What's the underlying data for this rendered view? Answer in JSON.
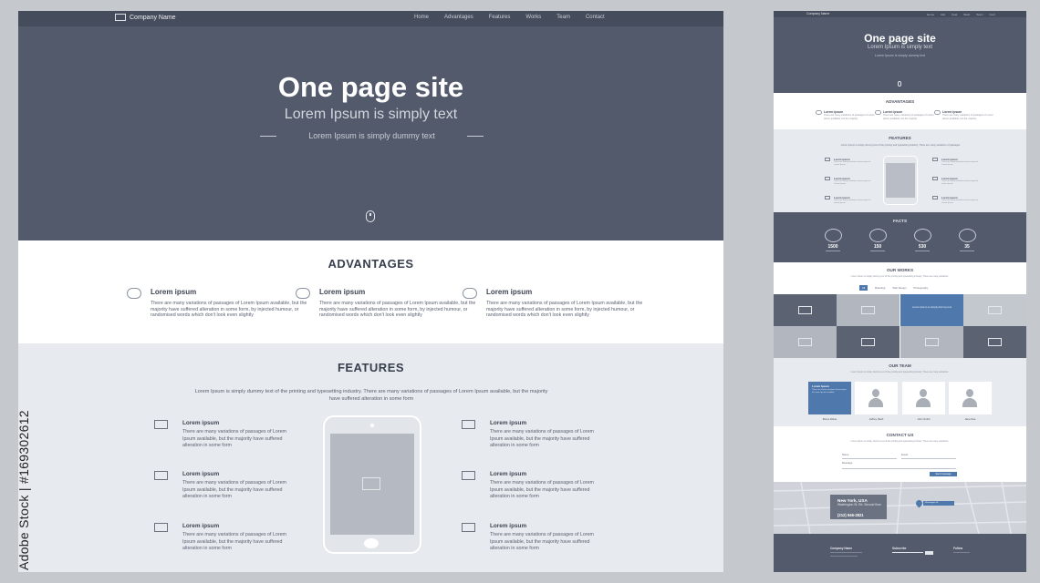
{
  "main": {
    "logo": "Company Name",
    "nav": [
      "Home",
      "Advantages",
      "Features",
      "Works",
      "Team",
      "Contact"
    ],
    "hero": {
      "title": "One page site",
      "subtitle": "Lorem Ipsum is simply text",
      "tagline": "Lorem Ipsum is simply dummy text"
    },
    "advantages": {
      "title": "ADVANTAGES",
      "items": [
        {
          "title": "Lorem ipsum",
          "text": "There are many variations of passages of Lorem Ipsum available, but the majority have suffered alteration in some form, by injected humour, or randomised words which don't look even slightly"
        },
        {
          "title": "Lorem ipsum",
          "text": "There are many variations of passages of Lorem Ipsum available, but the majority have suffered alteration in some form, by injected humour, or randomised words which don't look even slightly"
        },
        {
          "title": "Lorem ipsum",
          "text": "There are many variations of passages of Lorem Ipsum available, but the majority have suffered alteration in some form, by injected humour, or randomised words which don't look even slightly"
        }
      ]
    },
    "features": {
      "title": "FEATURES",
      "intro": "Lorem Ipsum is simply dummy text of the printing and typesetting industry. There are many variations of passages of Lorem Ipsum available, but the majority have suffered alteration in some form",
      "items": [
        {
          "title": "Lorem ipsum",
          "text": "There are many variations of passages of Lorem Ipsum available, but the majority have suffered alteration in some form"
        },
        {
          "title": "Lorem ipsum",
          "text": "There are many variations of passages of Lorem Ipsum available, but the majority have suffered alteration in some form"
        },
        {
          "title": "Lorem ipsum",
          "text": "There are many variations of passages of Lorem Ipsum available, but the majority have suffered alteration in some form"
        },
        {
          "title": "Lorem ipsum",
          "text": "There are many variations of passages of Lorem Ipsum available, but the majority have suffered alteration in some form"
        },
        {
          "title": "Lorem ipsum",
          "text": "There are many variations of passages of Lorem Ipsum available, but the majority have suffered alteration in some form"
        },
        {
          "title": "Lorem ipsum",
          "text": "There are many variations of passages of Lorem Ipsum available, but the majority have suffered alteration in some form"
        }
      ]
    }
  },
  "side": {
    "logo": "Company Name",
    "nav": [
      "Home",
      "Adv",
      "Feat",
      "Work",
      "Team",
      "Cont"
    ],
    "hero": {
      "title": "One page site",
      "subtitle": "Lorem Ipsum is simply text",
      "tagline": "Lorem Ipsum is simply dummy text"
    },
    "advantages_title": "ADVANTAGES",
    "adv_items": [
      {
        "title": "Lorem ipsum",
        "text": "There are many variations of passages of Lorem Ipsum available, but the majority"
      },
      {
        "title": "Lorem ipsum",
        "text": "There are many variations of passages of Lorem Ipsum available, but the majority"
      },
      {
        "title": "Lorem ipsum",
        "text": "There are many variations of passages of Lorem Ipsum available, but the majority"
      }
    ],
    "features_title": "FEATURES",
    "features_intro": "Lorem Ipsum is simply dummy text of the printing and typesetting industry. There are many variations of passages",
    "feat_items": [
      {
        "title": "Lorem ipsum",
        "text": "There are many variations of passages of Lorem Ipsum"
      },
      {
        "title": "Lorem ipsum",
        "text": "There are many variations of passages of Lorem Ipsum"
      },
      {
        "title": "Lorem ipsum",
        "text": "There are many variations of passages of Lorem Ipsum"
      },
      {
        "title": "Lorem ipsum",
        "text": "There are many variations of passages of Lorem Ipsum"
      },
      {
        "title": "Lorem ipsum",
        "text": "There are many variations of passages of Lorem Ipsum"
      },
      {
        "title": "Lorem ipsum",
        "text": "There are many variations of passages of Lorem Ipsum"
      }
    ],
    "facts_title": "FACTS",
    "facts": [
      "1500",
      "150",
      "530",
      "35"
    ],
    "works_title": "OUR WORKS",
    "works_intro": "Lorem Ipsum is simply dummy text of the printing and typesetting industry. There are many variations",
    "works_filters": [
      "All",
      "Branding",
      "Web Design",
      "Photography"
    ],
    "works_tile_caption": "Lorem Ipsum is simply dummy text",
    "team_title": "OUR TEAM",
    "team_intro": "Lorem Ipsum is simply dummy text of the printing and typesetting industry. There are many variations",
    "team_card": {
      "title": "Lorem Ipsum",
      "text": "There are many variations of passages of Lorem Ipsum available"
    },
    "team_names": [
      "Bruce Wane",
      "Jeffrey Nash",
      "John Smith",
      "Jane Doe"
    ],
    "contact_title": "CONTACT US",
    "contact_intro": "Lorem Ipsum is simply dummy text of the printing and typesetting industry. There are many variations",
    "contact_fields": [
      "Name",
      "Email",
      "Message"
    ],
    "contact_button": "Send message",
    "map": {
      "city": "New York, USA",
      "address": "Washington St. Rd. Second floor",
      "phone": "(212) 946-2821",
      "pin_label": "Washington St."
    },
    "footer": {
      "company": "Company Name",
      "subscribe": "Subscribe",
      "follow": "Follow"
    }
  },
  "credit": "Adobe Stock | #169302612",
  "colors": {
    "hero": "#525a6b",
    "accent": "#4f79ad",
    "section_alt": "#e7eaef"
  }
}
